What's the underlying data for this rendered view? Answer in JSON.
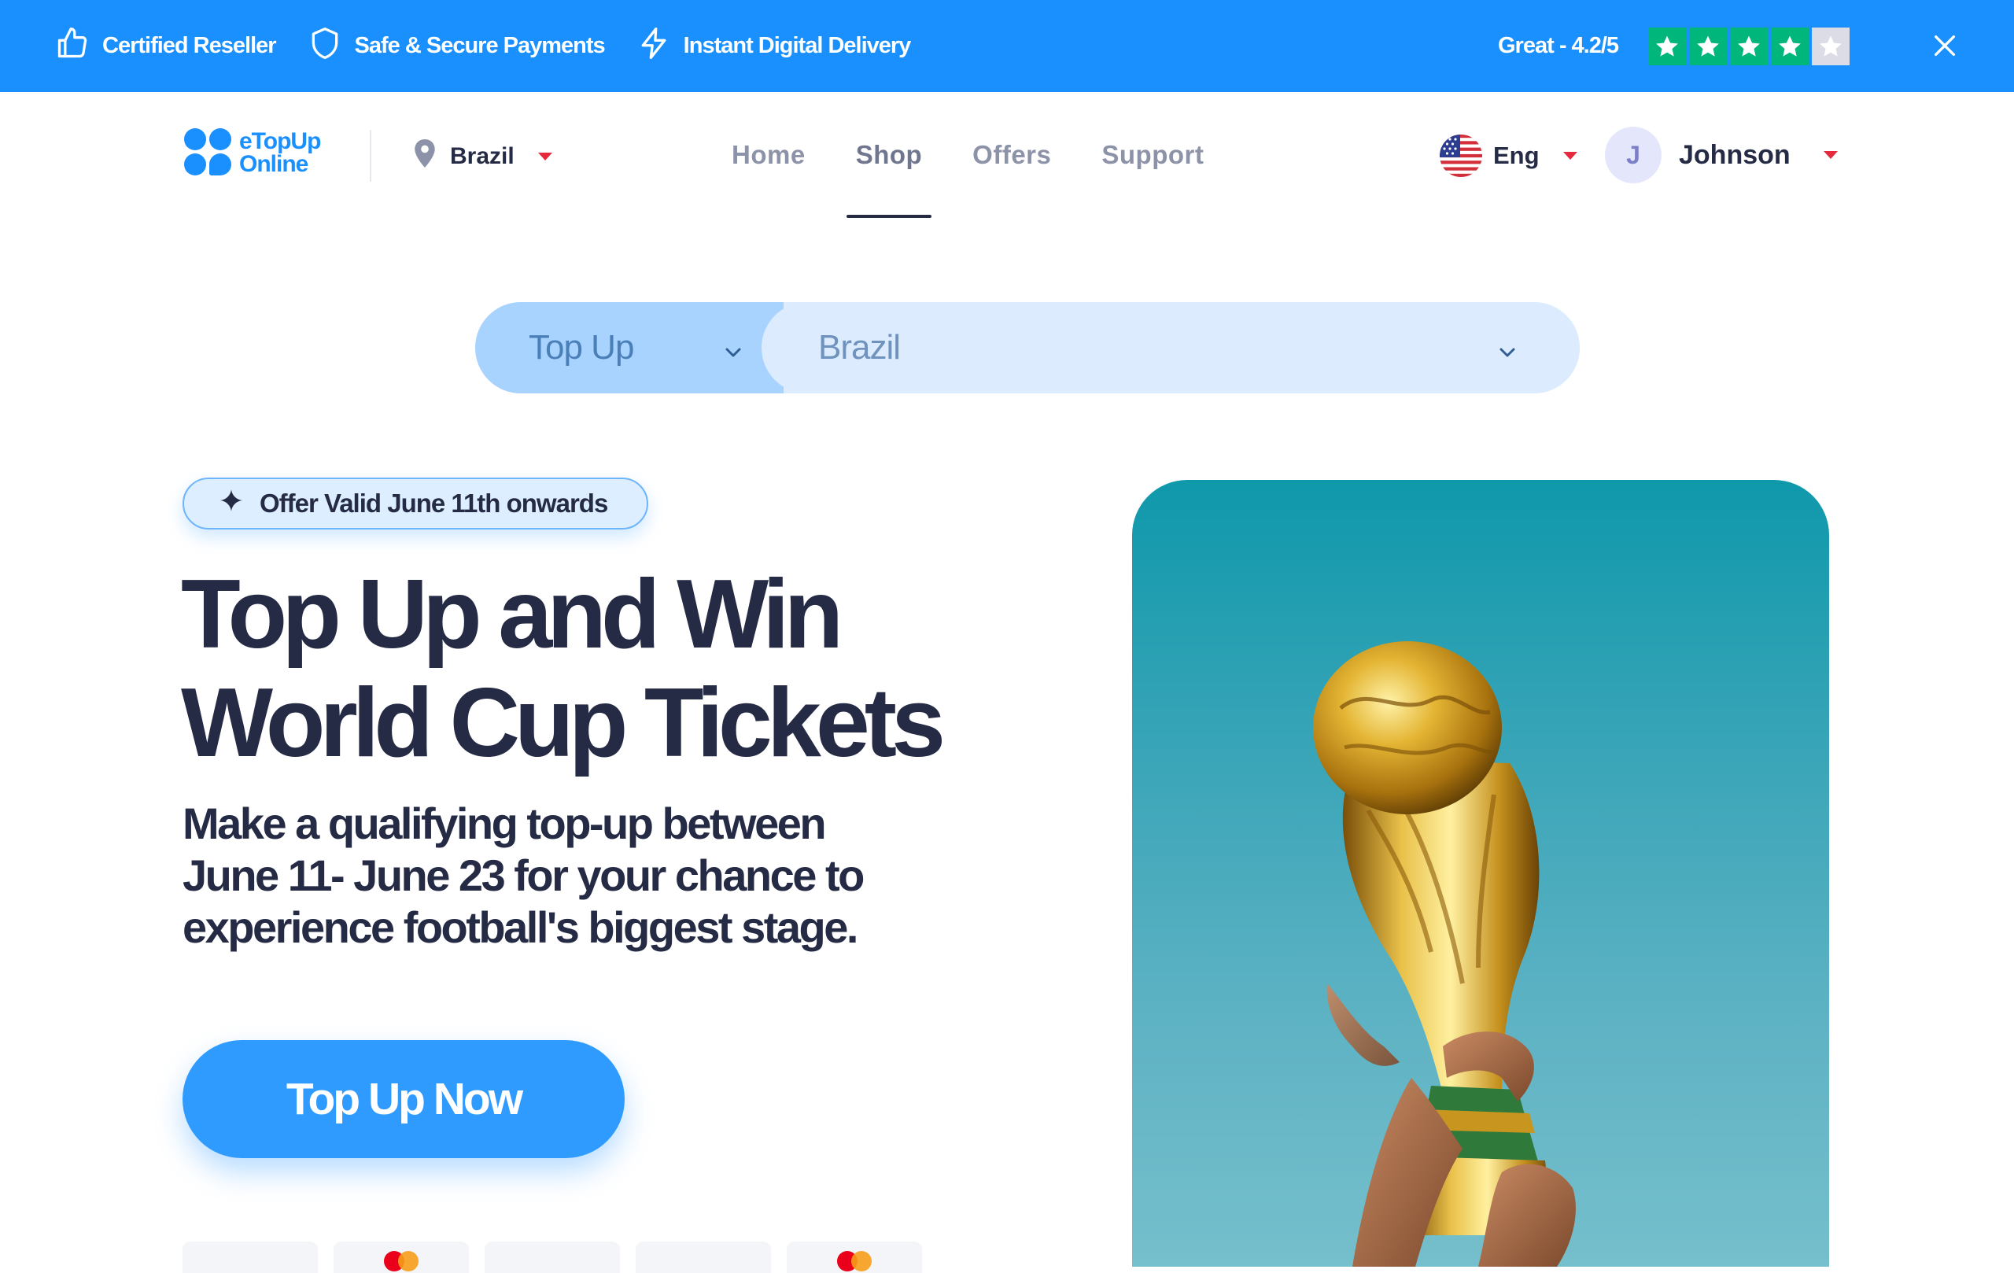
{
  "topbar": {
    "features": [
      {
        "icon": "thumbs-up-icon",
        "label": "Certified Reseller"
      },
      {
        "icon": "shield-icon",
        "label": "Safe & Secure Payments"
      },
      {
        "icon": "lightning-icon",
        "label": "Instant Digital Delivery"
      }
    ],
    "rating_text": "Great - 4.2/5",
    "rating_value": 4.2,
    "rating_max": 5,
    "colors": {
      "bar": "#1a90ff",
      "star_green": "#00b67a"
    }
  },
  "header": {
    "logo": {
      "line1": "eTopUp",
      "line2": "Online"
    },
    "country": "Brazil",
    "nav": [
      {
        "label": "Home",
        "active": false
      },
      {
        "label": "Shop",
        "active": true
      },
      {
        "label": "Offers",
        "active": false
      },
      {
        "label": "Support",
        "active": false
      }
    ],
    "language": "Eng",
    "user": {
      "initial": "J",
      "name": "Johnson"
    }
  },
  "search": {
    "type_value": "Top Up",
    "country_value": "Brazil"
  },
  "hero": {
    "badge": "Offer Valid June 11th onwards",
    "title_line1": "Top Up and Win",
    "title_line2": "World Cup Tickets",
    "subtitle_line1": "Make a qualifying top-up between",
    "subtitle_line2": "June 11- June 23 for your chance to",
    "subtitle_line3": "experience football's biggest stage.",
    "cta": "Top Up Now"
  }
}
